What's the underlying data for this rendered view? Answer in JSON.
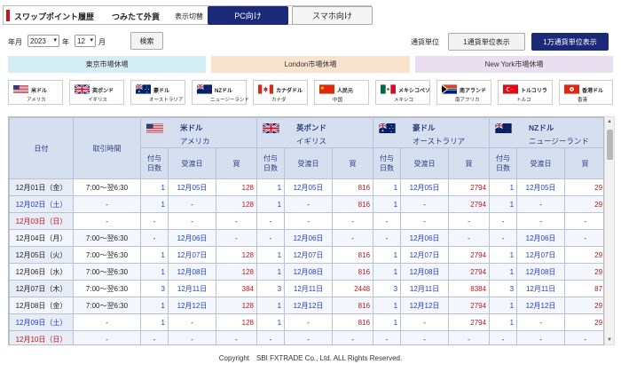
{
  "header": {
    "title": "スワップポイント履歴",
    "subtitle": "つみたて外貨",
    "toggle_label": "表示切替",
    "pc_btn": "PC向け",
    "sp_btn": "スマホ向け"
  },
  "filter": {
    "year_label": "年月",
    "year": "2023",
    "year_unit": "年",
    "month": "12",
    "month_unit": "月",
    "search_btn": "検索",
    "unit_label": "通貨単位",
    "unit1": "1通貨単位表示",
    "unit2": "1万通貨単位表示"
  },
  "markets": {
    "tokyo": "東京市場休場",
    "london": "London市場休場",
    "newyork": "New York市場休場"
  },
  "currencies": [
    {
      "name": "米ドル",
      "country": "アメリカ",
      "flag": "us-flag-icon"
    },
    {
      "name": "英ポンド",
      "country": "イギリス",
      "flag": "gb-flag-icon"
    },
    {
      "name": "豪ドル",
      "country": "オーストラリア",
      "flag": "au-flag-icon"
    },
    {
      "name": "NZドル",
      "country": "ニュージーランド",
      "flag": "nz-flag-icon"
    },
    {
      "name": "カナダドル",
      "country": "カナダ",
      "flag": "ca-flag-icon"
    },
    {
      "name": "人民元",
      "country": "中国",
      "flag": "cn-flag-icon"
    },
    {
      "name": "メキシコペソ",
      "country": "メキシコ",
      "flag": "mx-flag-icon"
    },
    {
      "name": "南アランド",
      "country": "南アフリカ",
      "flag": "za-flag-icon"
    },
    {
      "name": "トルコリラ",
      "country": "トルコ",
      "flag": "tr-flag-icon"
    },
    {
      "name": "香港ドル",
      "country": "香港",
      "flag": "hk-flag-icon"
    }
  ],
  "table": {
    "col_date": "日付",
    "col_time": "取引時間",
    "groups": [
      {
        "name": "米ドル",
        "country": "アメリカ"
      },
      {
        "name": "英ポンド",
        "country": "イギリス"
      },
      {
        "name": "豪ドル",
        "country": "オーストラリア"
      },
      {
        "name": "NZドル",
        "country": "ニュージーランド"
      }
    ],
    "sub_days": "付与\n日数",
    "sub_delivery": "受渡日",
    "sub_buy": "買",
    "rows": [
      {
        "date": "12月01日（金）",
        "day": "wk",
        "time": "7:00～翌6:30",
        "c": [
          [
            "1",
            "12月05日",
            "128"
          ],
          [
            "1",
            "12月05日",
            "816"
          ],
          [
            "1",
            "12月05日",
            "2794"
          ],
          [
            "1",
            "12月05日",
            "29"
          ]
        ]
      },
      {
        "date": "12月02日（土）",
        "day": "sat",
        "time": "-",
        "c": [
          [
            "1",
            "-",
            "128"
          ],
          [
            "1",
            "-",
            "816"
          ],
          [
            "1",
            "-",
            "2794"
          ],
          [
            "1",
            "-",
            "29"
          ]
        ]
      },
      {
        "date": "12月03日（日）",
        "day": "sun",
        "time": "-",
        "c": [
          [
            "-",
            "-",
            "-"
          ],
          [
            "-",
            "-",
            "-"
          ],
          [
            "-",
            "-",
            "-"
          ],
          [
            "-",
            "-",
            "-"
          ]
        ]
      },
      {
        "date": "12月04日（月）",
        "day": "wk",
        "time": "7:00～翌6:30",
        "c": [
          [
            "-",
            "12月06日",
            "-"
          ],
          [
            "-",
            "12月06日",
            "-"
          ],
          [
            "-",
            "12月06日",
            "-"
          ],
          [
            "-",
            "12月06日",
            "-"
          ]
        ]
      },
      {
        "date": "12月05日（火）",
        "day": "wk",
        "time": "7:00～翌6:30",
        "c": [
          [
            "1",
            "12月07日",
            "128"
          ],
          [
            "1",
            "12月07日",
            "816"
          ],
          [
            "1",
            "12月07日",
            "2794"
          ],
          [
            "1",
            "12月07日",
            "29"
          ]
        ]
      },
      {
        "date": "12月06日（水）",
        "day": "wk",
        "time": "7:00～翌6:30",
        "c": [
          [
            "1",
            "12月08日",
            "128"
          ],
          [
            "1",
            "12月08日",
            "816"
          ],
          [
            "1",
            "12月08日",
            "2794"
          ],
          [
            "1",
            "12月08日",
            "29"
          ]
        ]
      },
      {
        "date": "12月07日（木）",
        "day": "wk",
        "time": "7:00～翌6:30",
        "c": [
          [
            "3",
            "12月11日",
            "384"
          ],
          [
            "3",
            "12月11日",
            "2448"
          ],
          [
            "3",
            "12月11日",
            "8384"
          ],
          [
            "3",
            "12月11日",
            "87"
          ]
        ]
      },
      {
        "date": "12月08日（金）",
        "day": "wk",
        "time": "7:00～翌6:30",
        "c": [
          [
            "1",
            "12月12日",
            "128"
          ],
          [
            "1",
            "12月12日",
            "816"
          ],
          [
            "1",
            "12月12日",
            "2794"
          ],
          [
            "1",
            "12月12日",
            "29"
          ]
        ]
      },
      {
        "date": "12月09日（土）",
        "day": "sat",
        "time": "-",
        "c": [
          [
            "1",
            "-",
            "128"
          ],
          [
            "1",
            "-",
            "816"
          ],
          [
            "1",
            "-",
            "2794"
          ],
          [
            "1",
            "-",
            "29"
          ]
        ]
      },
      {
        "date": "12月10日（日）",
        "day": "sun",
        "time": "-",
        "c": [
          [
            "-",
            "-",
            "-"
          ],
          [
            "-",
            "-",
            "-"
          ],
          [
            "-",
            "-",
            "-"
          ],
          [
            "-",
            "-",
            "-"
          ]
        ]
      }
    ]
  },
  "footer": "Copyright　SBI FXTRADE Co., Ltd. ALL Rights Reserved.",
  "colors": {
    "brand_red": "#c4161c",
    "navy": "#1a2a78",
    "header_blue": "#d6dff0",
    "tokyo": "#d4eef6",
    "london": "#f9e3cc",
    "newyork": "#e9dff1"
  }
}
